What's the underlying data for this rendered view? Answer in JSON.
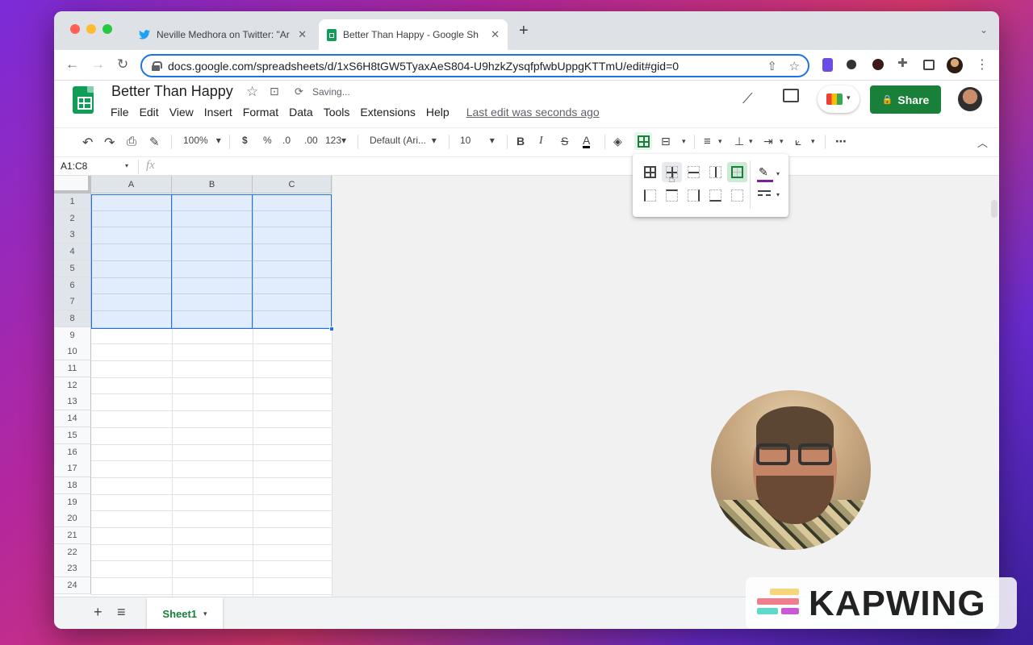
{
  "browser": {
    "tabs": [
      {
        "title": "Neville Medhora on Twitter: \"Ar",
        "icon": "twitter-icon"
      },
      {
        "title": "Better Than Happy - Google Sh",
        "icon": "sheets-icon"
      }
    ],
    "url": "docs.google.com/spreadsheets/d/1xS6H8tGW5TyaxAeS804-U9hzkZysqfpfwbUppgKTTmU/edit#gid=0"
  },
  "doc": {
    "title": "Better Than Happy",
    "status": "Saving...",
    "last_edit": "Last edit was seconds ago",
    "menu": [
      "File",
      "Edit",
      "View",
      "Insert",
      "Format",
      "Data",
      "Tools",
      "Extensions",
      "Help"
    ],
    "share_label": "Share"
  },
  "toolbar": {
    "zoom": "100%",
    "currency": "$",
    "percent": "%",
    "dec_decrease": ".0",
    "dec_increase": ".00",
    "more_formats": "123",
    "font": "Default (Ari...",
    "font_size": "10",
    "bold": "B",
    "italic": "I",
    "strike": "S",
    "text_color": "A",
    "more": "⋯"
  },
  "formula_bar": {
    "name_box": "A1:C8",
    "fx": "fx",
    "value": ""
  },
  "grid": {
    "columns": [
      "A",
      "B",
      "C"
    ],
    "rows": [
      "1",
      "2",
      "3",
      "4",
      "5",
      "6",
      "7",
      "8",
      "9",
      "10",
      "11",
      "12",
      "13",
      "14",
      "15",
      "16",
      "17",
      "18",
      "19",
      "20",
      "21",
      "22",
      "23",
      "24"
    ],
    "selection": "A1:C8"
  },
  "sheets": {
    "active": "Sheet1",
    "add": "+",
    "list": "≡"
  },
  "watermark": "KAPWING",
  "colors": {
    "accent": "#1a73e8",
    "share": "#188038",
    "sheets": "#0f9d58"
  }
}
